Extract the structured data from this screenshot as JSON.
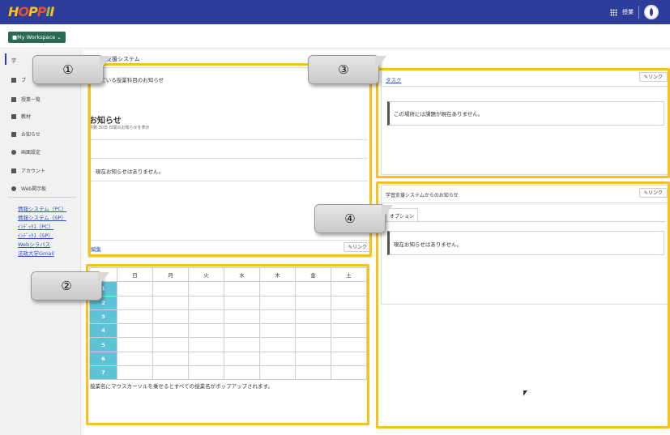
{
  "header": {
    "logo_text": "HOPPII",
    "logo_letters": [
      "H",
      "O",
      "P",
      "P",
      "I",
      "I"
    ],
    "user_label": "授業",
    "icons": {
      "apps": "grid-icon",
      "user": "avatar-icon"
    },
    "colors": {
      "bar": "#2f3d9a",
      "accent": "#f7c21c",
      "workspace": "#2b6b56"
    }
  },
  "workspace": {
    "button_label": "My Workspace"
  },
  "sidebar": {
    "items": [
      {
        "label": "学",
        "icon": "home-icon"
      },
      {
        "label": "プ",
        "icon": "person-icon"
      },
      {
        "label": "授業一覧",
        "icon": "class-icon"
      },
      {
        "label": "教材",
        "icon": "folder-icon"
      },
      {
        "label": "お知らせ",
        "icon": "megaphone-icon"
      },
      {
        "label": "画面設定",
        "icon": "gear-icon"
      },
      {
        "label": "アカウント",
        "icon": "user-icon"
      },
      {
        "label": "Web掲示板",
        "icon": "chat-icon"
      }
    ],
    "links": [
      "情報システム（PC）",
      "情報システム（SP）",
      "ｲﾝﾃﾞｯｸｽ（PC）",
      "ｲﾝﾃﾞｯｸｽ（SP）",
      "Webシラバス",
      "法政大学Gmail"
    ]
  },
  "main": {
    "page_title": "習支援システム",
    "panel1": {
      "header": "している授業科目のお知らせ",
      "title": "お知らせ",
      "subtitle": "件数 30日 日間のお知らせを表示",
      "empty_message": "現在お知らせはありません。",
      "footer_label": "編集",
      "link_label": "✎リンク"
    },
    "panel3": {
      "header": "タスク",
      "link_label": "✎リンク",
      "empty_message": "この場所には課題が現在ありません。"
    },
    "panel4": {
      "header": "学習支援システムからのお知らせ",
      "link_label": "✎リンク",
      "tab_label": "オプション",
      "empty_message": "現在お知らせはありません。"
    },
    "timetable": {
      "days": [
        "日",
        "月",
        "火",
        "水",
        "木",
        "金",
        "土"
      ],
      "periods": [
        "1",
        "2",
        "3",
        "4",
        "5",
        "6",
        "7"
      ],
      "note": "授業名にマウスカーソルを乗せるとすべての授業名がポップアップされます。"
    }
  },
  "callouts": [
    "①",
    "②",
    "③",
    "④"
  ]
}
